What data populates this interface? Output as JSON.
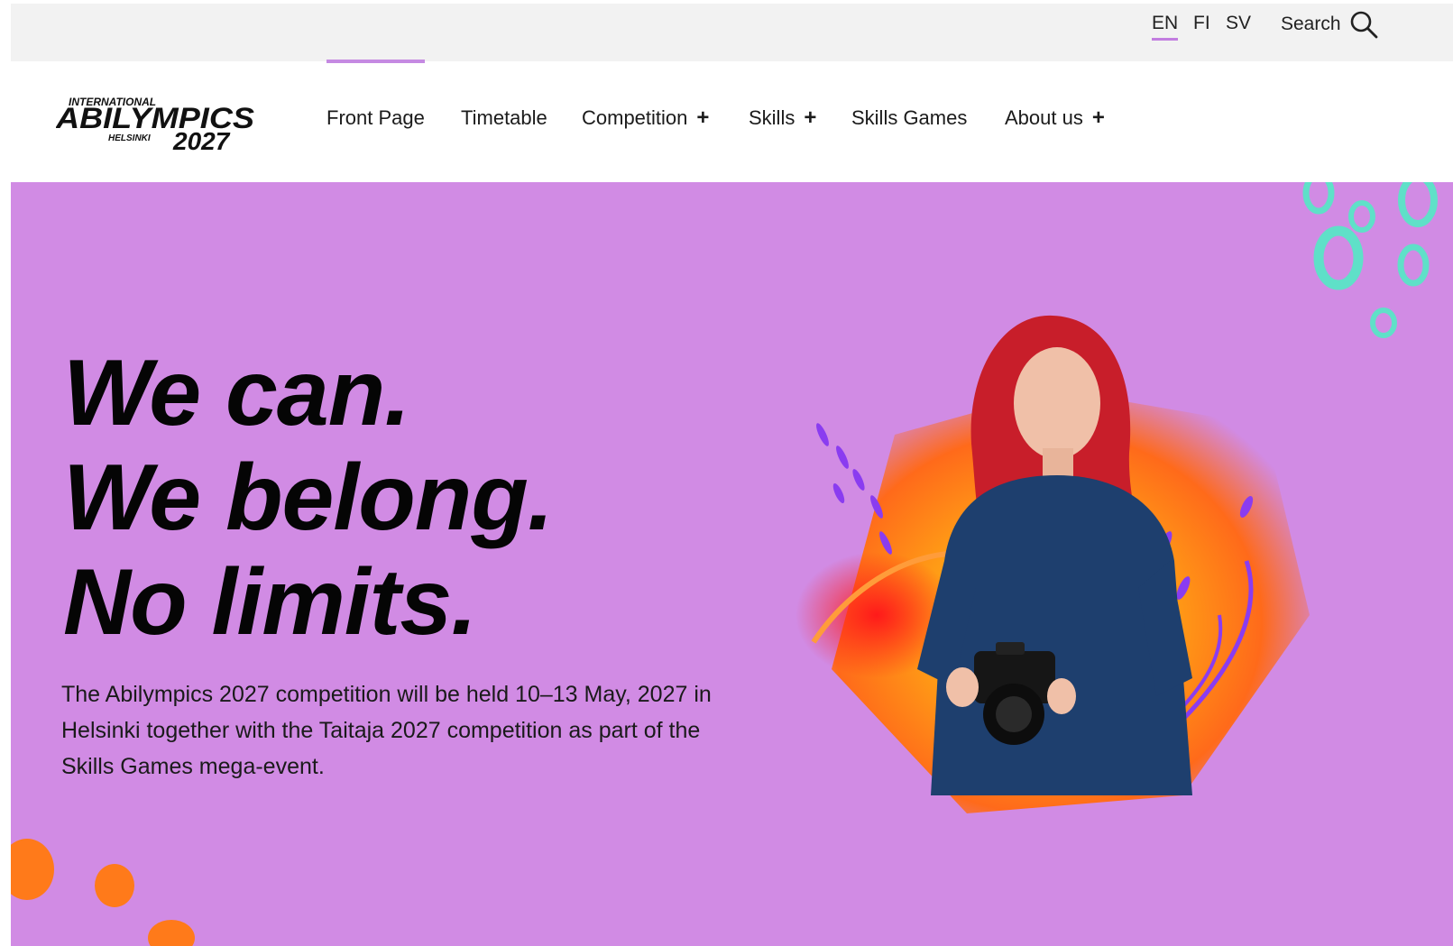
{
  "utility": {
    "languages": [
      {
        "code": "EN",
        "active": true
      },
      {
        "code": "FI",
        "active": false
      },
      {
        "code": "SV",
        "active": false
      }
    ],
    "search_label": "Search"
  },
  "header": {
    "logo": {
      "line1": "INTERNATIONAL",
      "line2": "ABILYMPICS",
      "line3_city": "HELSINKI",
      "line3_year": "2027"
    },
    "nav": [
      {
        "label": "Front Page",
        "has_submenu": false,
        "active": true
      },
      {
        "label": "Timetable",
        "has_submenu": false
      },
      {
        "label": "Competition",
        "has_submenu": true
      },
      {
        "label": "Skills",
        "has_submenu": true
      },
      {
        "label": "Skills Games",
        "has_submenu": false
      },
      {
        "label": "About us",
        "has_submenu": true
      }
    ],
    "submenu_icon": "+"
  },
  "hero": {
    "heading_lines": [
      "We can.",
      "We belong.",
      "No limits."
    ],
    "description": "The Abilympics 2027 competition will be held 10–13 May, 2027 in Helsinki together with the Taitaja 2027 competition as part of the Skills Games mega-event.",
    "colors": {
      "background": "#d18be4",
      "accent_orange": "#ff7a1a",
      "accent_teal": "#5fe0c8",
      "accent_purple": "#8a3cf0"
    }
  }
}
